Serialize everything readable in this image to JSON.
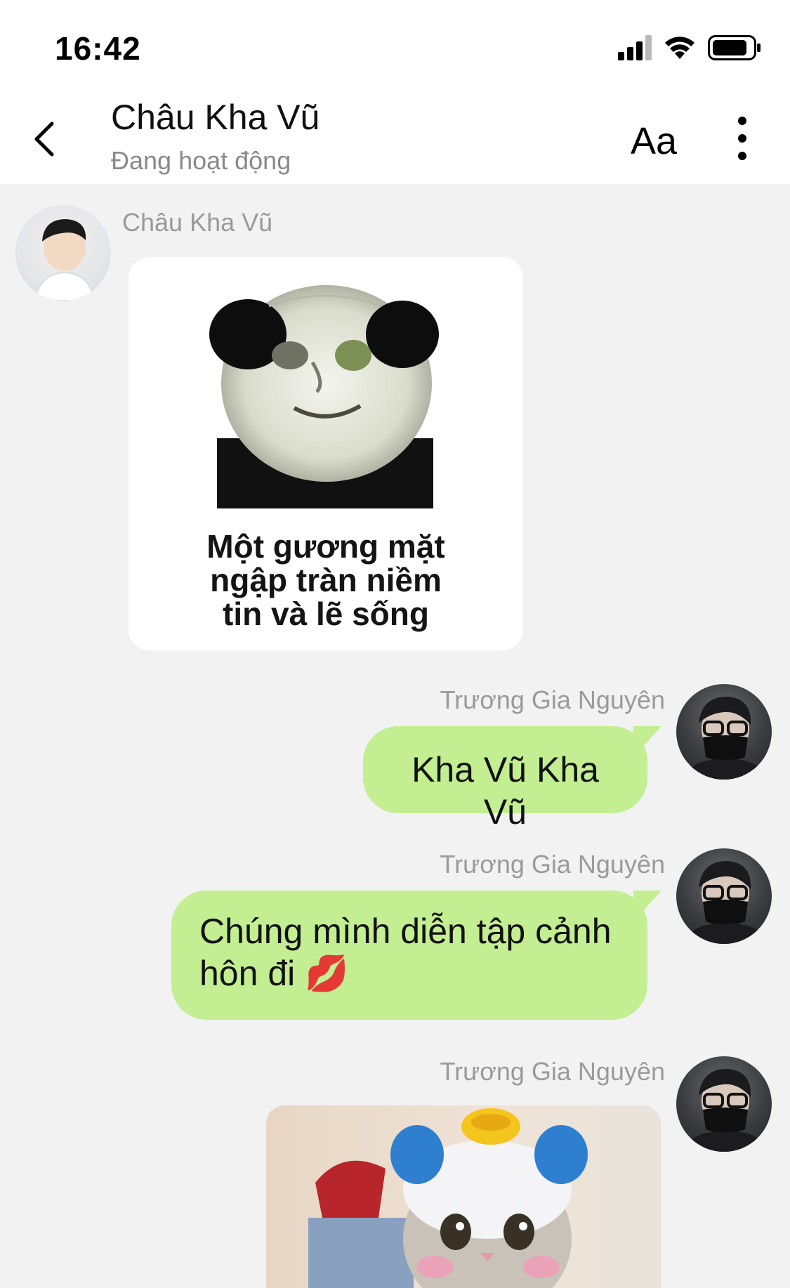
{
  "status_bar": {
    "time": "16:42",
    "icons": [
      "signal-icon",
      "wifi-icon",
      "battery-icon"
    ]
  },
  "header": {
    "title": "Châu Kha Vũ",
    "status": "Đang hoạt động",
    "font_button": "Aa",
    "icons": [
      "back-icon",
      "more-icon"
    ]
  },
  "messages": [
    {
      "sender": "Châu Kha Vũ",
      "side": "left",
      "type": "sticker",
      "caption_lines": [
        "Một gương mặt",
        "ngập tràn niềm",
        "tin và lẽ sống"
      ]
    },
    {
      "sender": "Trương Gia Nguyên",
      "side": "right",
      "type": "text",
      "text": "Kha Vũ Kha Vũ"
    },
    {
      "sender": "Trương Gia Nguyên",
      "side": "right",
      "type": "text",
      "text": "Chúng mình diễn tập cảnh",
      "text_line2": "hôn đi",
      "emoji": "💋"
    },
    {
      "sender": "Trương Gia Nguyên",
      "side": "right",
      "type": "image"
    }
  ],
  "colors": {
    "background": "#f2f2f3",
    "outgoing_bubble": "#c3ee91",
    "header": "#ffffff"
  }
}
